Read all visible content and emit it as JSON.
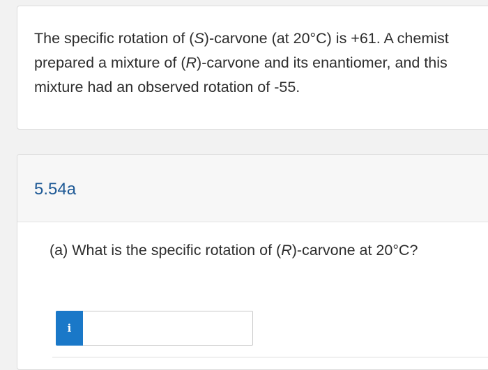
{
  "problem": {
    "text_part1": "The specific rotation of (",
    "text_italic1": "S",
    "text_part2": ")-carvone (at 20°C) is +61. A chemist prepared a mixture of (",
    "text_italic2": "R",
    "text_part3": ")-carvone and its enantiomer, and this mixture had an observed rotation of -55."
  },
  "question": {
    "id": "5.54a",
    "text_part1": "(a) What is the specific rotation of (",
    "text_italic": "R",
    "text_part2": ")-carvone at 20°C?",
    "info_icon_label": "i",
    "answer_value": "",
    "answer_placeholder": ""
  },
  "colors": {
    "accent": "#1a78c8",
    "question_id": "#1f5a96"
  },
  "icons": {
    "info": "info-icon"
  }
}
